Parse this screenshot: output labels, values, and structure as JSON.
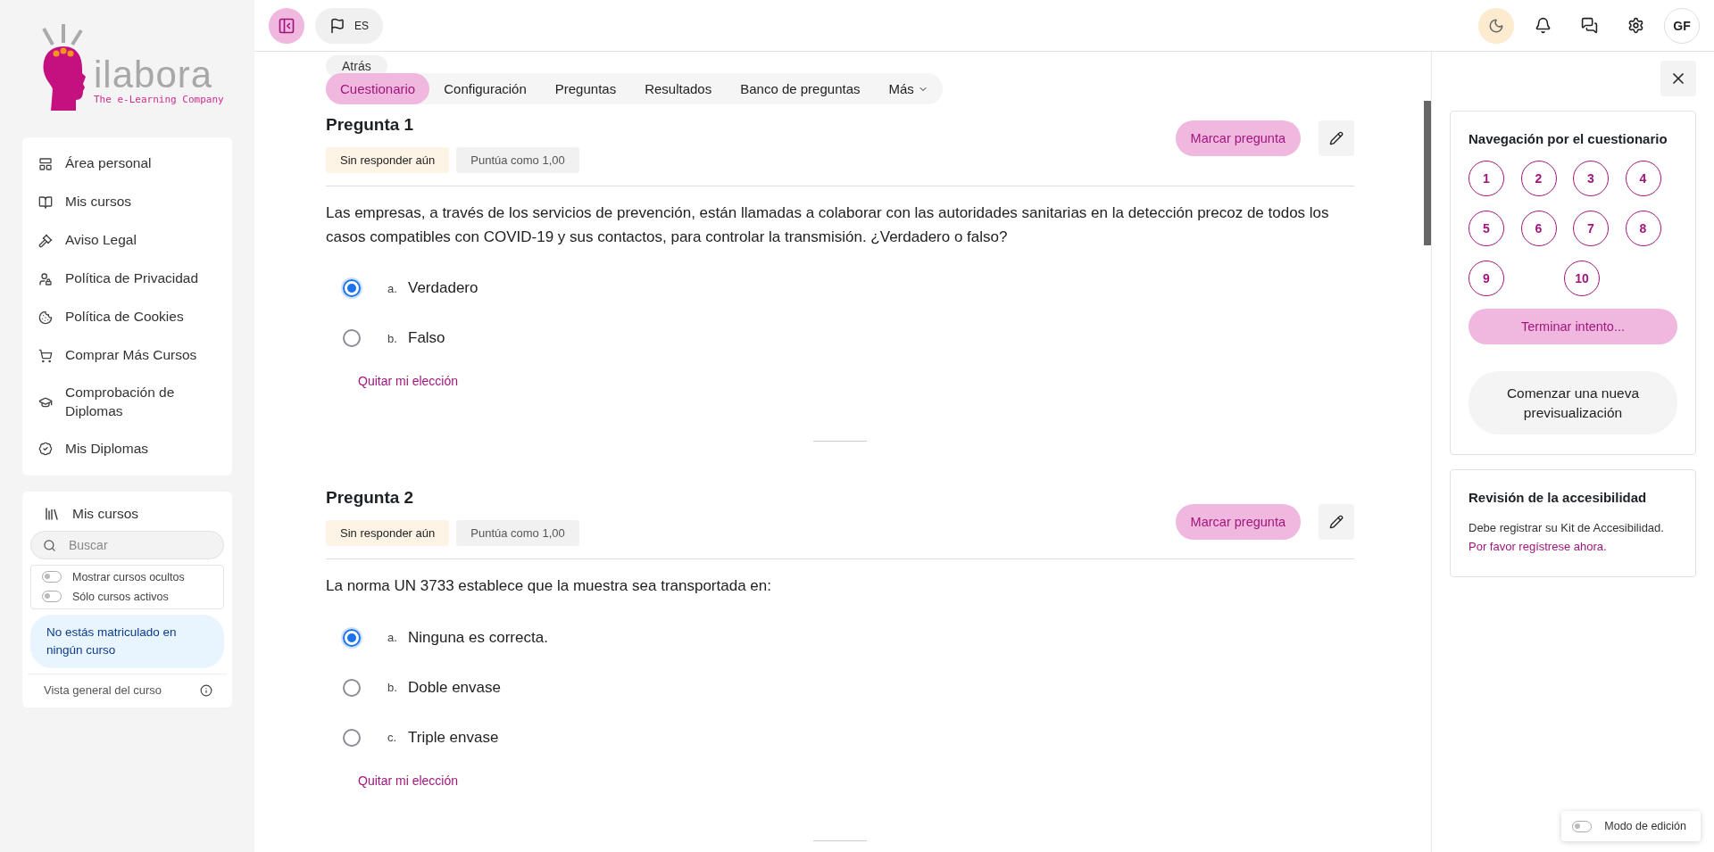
{
  "logo": {
    "name": "ilabora",
    "tagline": "The e-Learning Company"
  },
  "nav": {
    "items": [
      {
        "label": "Área personal"
      },
      {
        "label": "Mis cursos"
      },
      {
        "label": "Aviso Legal"
      },
      {
        "label": "Política de Privacidad"
      },
      {
        "label": "Política de Cookies"
      },
      {
        "label": "Comprar Más Cursos"
      },
      {
        "label": "Comprobación de Diplomas"
      },
      {
        "label": "Mis Diplomas"
      }
    ]
  },
  "courses_block": {
    "title": "Mis cursos",
    "search": {
      "placeholder": "Buscar"
    },
    "toggles": [
      {
        "label": "Mostrar cursos ocultos",
        "on": false
      },
      {
        "label": "Sólo cursos activos",
        "on": false
      }
    ],
    "notice": "No estás matriculado en ningún curso",
    "overview": "Vista general del curso"
  },
  "header": {
    "language": "ES",
    "avatar": "GF"
  },
  "back_button": "Atrás",
  "tabs": [
    {
      "label": "Cuestionario",
      "selected": true,
      "kind": "link"
    },
    {
      "label": "Configuración",
      "selected": false,
      "kind": "link"
    },
    {
      "label": "Preguntas",
      "selected": false,
      "kind": "link"
    },
    {
      "label": "Resultados",
      "selected": false,
      "kind": "link"
    },
    {
      "label": "Banco de preguntas",
      "selected": false,
      "kind": "link"
    },
    {
      "label": "Más",
      "selected": false,
      "kind": "dropdown"
    }
  ],
  "questions": [
    {
      "title": "Pregunta 1",
      "status": "Sin responder aún",
      "grade": "Puntúa como 1,00",
      "flag_button": "Marcar pregunta",
      "text": "Las empresas, a través de los servicios de prevención, están llamadas a colaborar con las autoridades sanitarias en la detección precoz de todos los casos compatibles con COVID-19 y sus contactos, para controlar la transmisión. ¿Verdadero o falso?",
      "options": [
        {
          "letter": "a.",
          "text": "Verdadero",
          "selected": true
        },
        {
          "letter": "b.",
          "text": "Falso",
          "selected": false
        }
      ],
      "clear_choice": "Quitar mi elección"
    },
    {
      "title": "Pregunta 2",
      "status": "Sin responder aún",
      "grade": "Puntúa como 1,00",
      "flag_button": "Marcar pregunta",
      "text": "La norma UN 3733 establece que la muestra sea transportada en:",
      "options": [
        {
          "letter": "a.",
          "text": "Ninguna es correcta.",
          "selected": true
        },
        {
          "letter": "b.",
          "text": "Doble envase",
          "selected": false
        },
        {
          "letter": "c.",
          "text": "Triple envase",
          "selected": false
        }
      ],
      "clear_choice": "Quitar mi elección"
    }
  ],
  "drawer": {
    "nav_title": "Navegación por el cuestionario",
    "numbers": [
      "1",
      "2",
      "3",
      "4",
      "5",
      "6",
      "7",
      "8",
      "9",
      "10"
    ],
    "finish": "Terminar intento...",
    "new_preview": "Comenzar una nueva previsualización",
    "access_title": "Revisión de la accesibilidad",
    "access_text": "Debe registrar su Kit de Accesibilidad.",
    "access_link": "Por favor regístrese ahora."
  },
  "edit_mode": {
    "label": "Modo de edición",
    "on": false
  }
}
